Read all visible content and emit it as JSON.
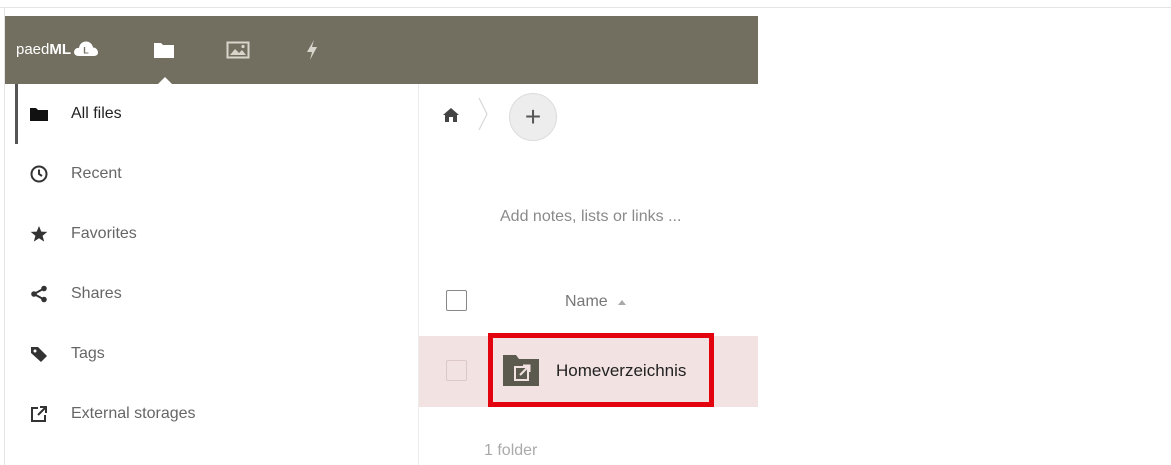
{
  "header": {
    "logo_light": "paed",
    "logo_bold": "ML",
    "logo_badge": "L",
    "nav_icons": [
      "folder-icon",
      "image-icon",
      "lightning-icon"
    ],
    "bg_color": "#726f61"
  },
  "sidebar": {
    "items": [
      {
        "label": "All files",
        "icon": "folder-icon",
        "active": true
      },
      {
        "label": "Recent",
        "icon": "clock-icon",
        "active": false
      },
      {
        "label": "Favorites",
        "icon": "star-icon",
        "active": false
      },
      {
        "label": "Shares",
        "icon": "share-icon",
        "active": false
      },
      {
        "label": "Tags",
        "icon": "tag-icon",
        "active": false
      },
      {
        "label": "External storages",
        "icon": "external-link-icon",
        "active": false
      }
    ]
  },
  "main": {
    "breadcrumb_icon": "home-icon",
    "add_button_label": "+",
    "notes_placeholder": "Add notes, lists or links ...",
    "table": {
      "column_name": "Name",
      "rows": [
        {
          "name": "Homeverzeichnis",
          "type": "external-folder"
        }
      ]
    },
    "footer_count": "1 folder"
  },
  "colors": {
    "row_highlight": "#f2e2e2",
    "annotation_box": "#e3030f"
  }
}
